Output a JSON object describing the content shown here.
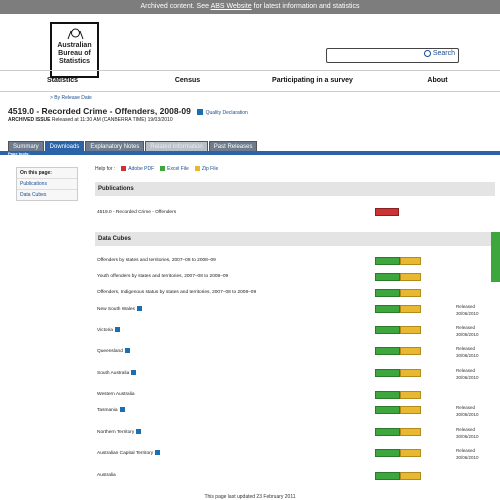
{
  "banner": {
    "prefix": "Archived content. See ",
    "link": "ABS Website",
    "suffix": " for latest information and statistics"
  },
  "logo": {
    "line1": "Australian",
    "line2": "Bureau of",
    "line3": "Statistics"
  },
  "search": {
    "button": "Search",
    "placeholder": ""
  },
  "nav": [
    "Statistics",
    "Census",
    "Participating in a survey",
    "About"
  ],
  "breadcrumb": "> By Release Date",
  "title": "4519.0 - Recorded Crime - Offenders, 2008-09",
  "quality": "Quality Declaration",
  "issue": {
    "label": "ARCHIVED ISSUE",
    "text": " Released at 11:30 AM (CANBERRA TIME) 19/03/2010"
  },
  "tabs": [
    "Summary",
    "Downloads",
    "Explanatory Notes",
    "Related Information",
    "Past Releases"
  ],
  "page_tools": "Page tools:",
  "sidebar": {
    "heading": "On this page:",
    "links": [
      "Publications",
      "Data Cubes"
    ]
  },
  "help": {
    "label": "Help for :",
    "pdf": "Adobe PDF",
    "excel": "Excel File",
    "zip": "Zip File"
  },
  "publications": {
    "heading": "Publications",
    "item": "4519.0 - Recorded Crime - Offenders"
  },
  "datacubes": {
    "heading": "Data Cubes",
    "rows": [
      {
        "label": "Offenders by states and territories, 2007–08 to 2008–09",
        "info": false,
        "released": ""
      },
      {
        "label": "Youth offenders by states and territories, 2007–08 to 2008–09",
        "info": false,
        "released": ""
      },
      {
        "label": "Offenders, Indigenous status by states and territories, 2007–08 to 2008–09",
        "info": false,
        "released": ""
      },
      {
        "label": "New South Wales",
        "info": true,
        "released": "Released",
        "date": "30/06/2010"
      },
      {
        "label": "Victoria",
        "info": true,
        "released": "Released",
        "date": "30/06/2010"
      },
      {
        "label": "Queensland",
        "info": true,
        "released": "Released",
        "date": "30/06/2010"
      },
      {
        "label": "South Australia",
        "info": true,
        "released": "Released",
        "date": "30/06/2010"
      },
      {
        "label": "Western Australia",
        "info": false,
        "released": ""
      },
      {
        "label": "Tasmania",
        "info": true,
        "released": "Released",
        "date": "30/06/2010"
      },
      {
        "label": "Northern Territory",
        "info": true,
        "released": "Released",
        "date": "30/06/2010"
      },
      {
        "label": "Australian Capital Territory",
        "info": true,
        "released": "Released",
        "date": "30/06/2010"
      },
      {
        "label": "Australia",
        "info": false,
        "released": ""
      }
    ]
  },
  "footer": "This page last updated 23 February 2011",
  "colors": {
    "accent": "#2a63a8",
    "banner": "#7d7d7d",
    "xls": "#3da63d",
    "zip": "#e8b830"
  }
}
